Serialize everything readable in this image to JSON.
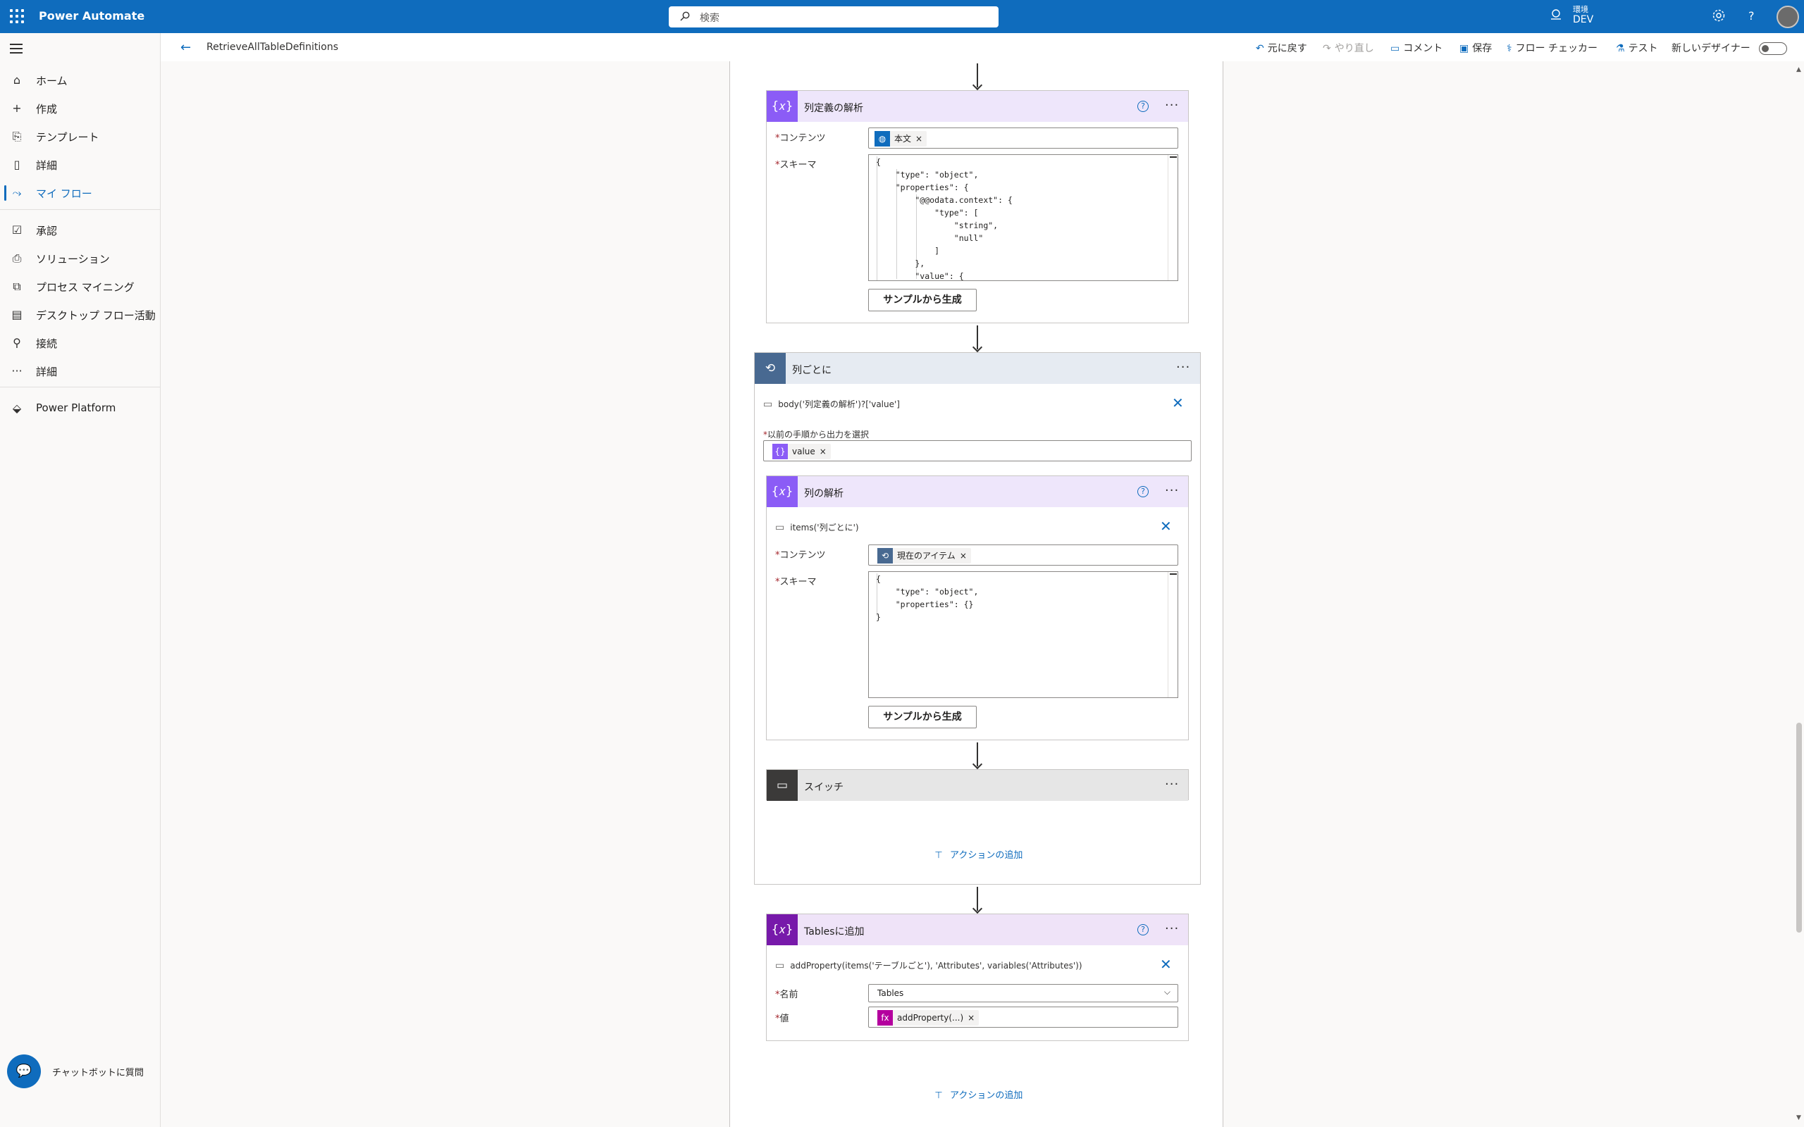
{
  "app": {
    "title": "Power Automate"
  },
  "search": {
    "placeholder": "検索"
  },
  "env": {
    "label": "環境",
    "value": "DEV"
  },
  "sidebar": {
    "items": [
      {
        "label": "ホーム",
        "icon": "home-icon"
      },
      {
        "label": "作成",
        "icon": "plus-icon"
      },
      {
        "label": "テンプレート",
        "icon": "template-icon"
      },
      {
        "label": "詳細",
        "icon": "book-icon"
      },
      {
        "label": "マイ フロー",
        "icon": "flow-icon"
      },
      {
        "label": "承認",
        "icon": "approval-icon"
      },
      {
        "label": "ソリューション",
        "icon": "solution-icon"
      },
      {
        "label": "プロセス マイニング",
        "icon": "process-mining-icon"
      },
      {
        "label": "デスクトップ フロー活動",
        "icon": "desktop-flow-icon"
      },
      {
        "label": "接続",
        "icon": "connection-icon"
      },
      {
        "label": "詳細",
        "icon": "more-icon"
      },
      {
        "label": "Power Platform",
        "icon": "power-platform-icon"
      }
    ],
    "chatbot": "チャットボットに質問"
  },
  "cmdbar": {
    "flow_name": "RetrieveAllTableDefinitions",
    "undo": "元に戻す",
    "redo": "やり直し",
    "comment": "コメント",
    "save": "保存",
    "checker": "フロー チェッカー",
    "test": "テスト",
    "new_designer": "新しいデザイナー"
  },
  "cards": {
    "parse_def": {
      "title": "列定義の解析",
      "content_label": "コンテンツ",
      "content_token": "本文",
      "schema_label": "スキーマ",
      "schema_lines": [
        "{",
        "    \"type\": \"object\",",
        "    \"properties\": {",
        "        \"@@odata.context\": {",
        "            \"type\": [",
        "                \"string\",",
        "                \"null\"",
        "            ]",
        "        },",
        "        \"value\": {"
      ],
      "gen_button": "サンプルから生成"
    },
    "foreach": {
      "title": "列ごとに",
      "expression": "body('列定義の解析')?['value']",
      "select_label": "以前の手順から出力を選択",
      "select_token": "value"
    },
    "parse_col": {
      "title": "列の解析",
      "expression": "items('列ごとに')",
      "content_label": "コンテンツ",
      "content_token": "現在のアイテム",
      "schema_label": "スキーマ",
      "schema_lines": [
        "{",
        "    \"type\": \"object\",",
        "    \"properties\": {}",
        "}"
      ],
      "gen_button": "サンプルから生成"
    },
    "switch": {
      "title": "スイッチ"
    },
    "add_action": "アクションの追加",
    "append": {
      "title": "Tablesに追加",
      "expression": "addProperty(items('テーブルごと'), 'Attributes', variables('Attributes'))",
      "name_label": "名前",
      "name_value": "Tables",
      "value_label": "値",
      "value_token": "addProperty(...)"
    },
    "add_action_bottom": "アクションの追加"
  },
  "colors": {
    "brand": "#0f6cbd",
    "parse_json": "#8b5cf6",
    "variable": "#7719aa",
    "control": "#486991",
    "switch": "#3b3a39"
  }
}
